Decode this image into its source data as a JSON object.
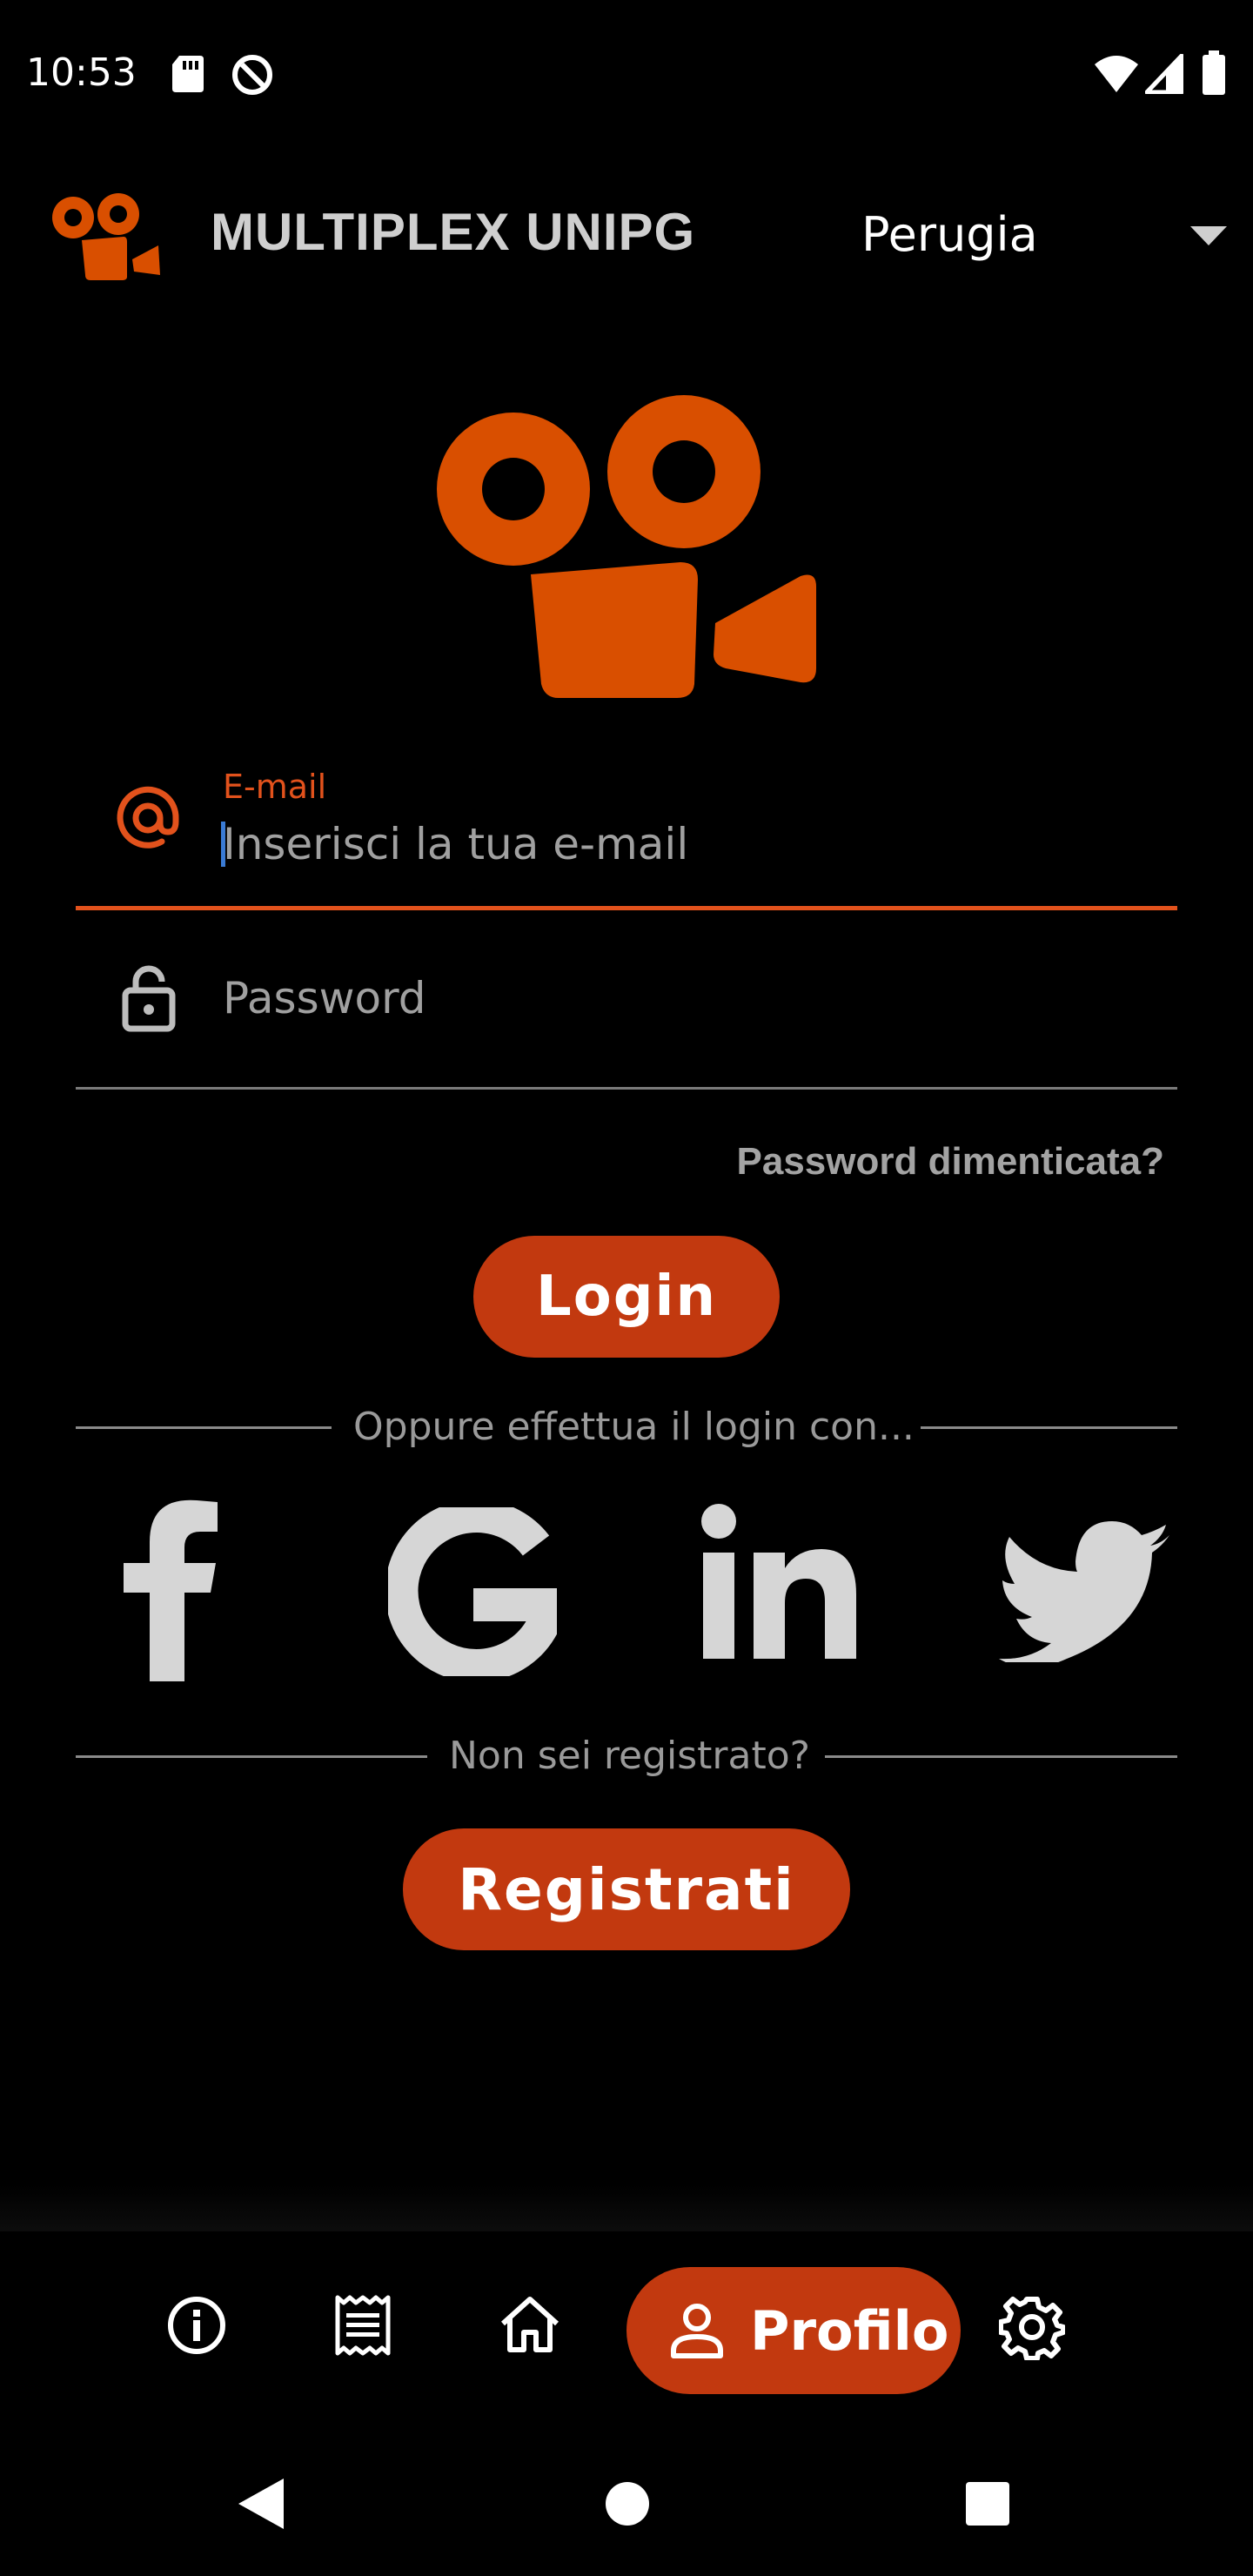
{
  "status_bar": {
    "time": "10:53",
    "icons": [
      "sd-card-icon",
      "data-saver-icon",
      "wifi-icon",
      "signal-icon",
      "battery-icon"
    ]
  },
  "header": {
    "app_title": "MULTIPLEX UNIPG",
    "city": "Perugia"
  },
  "login_form": {
    "email_label": "E-mail",
    "email_placeholder": "Inserisci la tua e-mail",
    "password_placeholder": "Password",
    "forgot_password": "Password dimenticata?",
    "login_button": "Login"
  },
  "social_login": {
    "divider_text": "Oppure effettua il login con...",
    "providers": [
      "facebook-icon",
      "google-icon",
      "linkedin-icon",
      "twitter-icon"
    ]
  },
  "register": {
    "divider_text": "Non sei registrato?",
    "register_button": "Registrati"
  },
  "bottom_nav": {
    "items": [
      {
        "icon": "info-icon"
      },
      {
        "icon": "receipt-icon"
      },
      {
        "icon": "home-icon"
      },
      {
        "icon": "person-icon",
        "label": "Profilo",
        "active": true
      },
      {
        "icon": "settings-icon"
      }
    ]
  },
  "colors": {
    "accent": "#e2521c",
    "button": "#c2390f",
    "background": "#000000",
    "logo": "#d94f00"
  }
}
